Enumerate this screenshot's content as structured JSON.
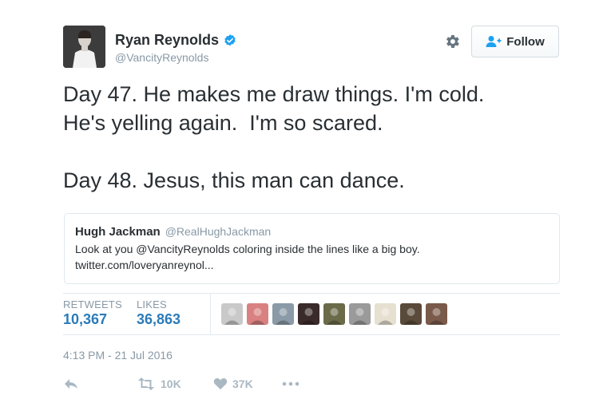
{
  "author": {
    "display_name": "Ryan Reynolds",
    "handle": "@VancityReynolds",
    "verified": true,
    "avatar_icon": "avatar-photo"
  },
  "header": {
    "settings_icon": "gear-icon",
    "follow_button": {
      "label": "Follow",
      "icon": "add-user-icon"
    }
  },
  "tweet": {
    "lines": [
      "Day 47. He makes me draw things. I'm cold.",
      "He's yelling again.  I'm so scared.",
      "",
      "Day 48. Jesus, this man can dance."
    ]
  },
  "quoted_tweet": {
    "display_name": "Hugh Jackman",
    "handle": "@RealHughJackman",
    "text": "Look at you @VancityReynolds coloring inside the lines like a big boy.",
    "link": "twitter.com/loveryanreynol..."
  },
  "stats": {
    "retweets_label": "RETWEETS",
    "retweets_value": "10,367",
    "likes_label": "LIKES",
    "likes_value": "36,863"
  },
  "likers": [
    {
      "color": "#c9c9c9"
    },
    {
      "color": "#d98080"
    },
    {
      "color": "#8a9aa6"
    },
    {
      "color": "#3b2a2a"
    },
    {
      "color": "#6b6b4a"
    },
    {
      "color": "#9a9a9a"
    },
    {
      "color": "#e6e0d0"
    },
    {
      "color": "#5a4a3a"
    },
    {
      "color": "#7a5a4a"
    }
  ],
  "timestamp": "4:13 PM - 21 Jul 2016",
  "actions": {
    "reply_icon": "reply-icon",
    "retweet_count": "10K",
    "like_count": "37K",
    "more_icon": "more-icon"
  },
  "colors": {
    "accent": "#2b7bb9",
    "verified": "#1da1f2",
    "muted": "#8899a6"
  }
}
